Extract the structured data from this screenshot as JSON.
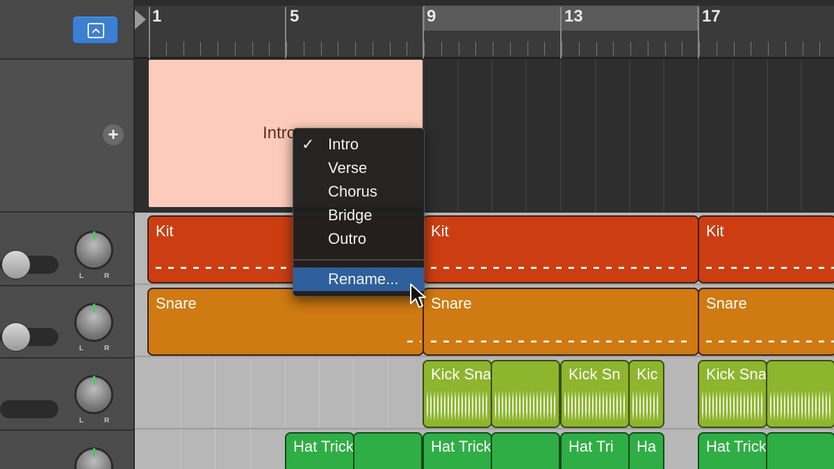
{
  "header": {
    "view_button_icon": "arrangement-view-icon",
    "add_icon": "+"
  },
  "ruler": {
    "bars": [
      "1",
      "5",
      "9",
      "13",
      "17"
    ]
  },
  "arrangement": {
    "region_label": "Intro"
  },
  "context_menu": {
    "items": [
      {
        "label": "Intro",
        "checked": true
      },
      {
        "label": "Verse",
        "checked": false
      },
      {
        "label": "Chorus",
        "checked": false
      },
      {
        "label": "Bridge",
        "checked": false
      },
      {
        "label": "Outro",
        "checked": false
      }
    ],
    "rename_label": "Rename..."
  },
  "tracks": {
    "knob_left": "L",
    "knob_right": "R",
    "kit": [
      "Kit",
      "Kit",
      "Kit"
    ],
    "snare": [
      "Snare",
      "Snare",
      "Snare"
    ],
    "loop": [
      "Kick Snare Loop",
      "Kick Sn",
      "Kic",
      "Kick Snare Loop"
    ],
    "hat": [
      "Hat Trick House",
      "Hat Trick House",
      "Hat Tri",
      "Ha",
      "Hat Trick House"
    ]
  },
  "colors": {
    "kit": "#cc3e12",
    "snare": "#cf7a12",
    "loop": "#8db52e",
    "hat": "#2fae45",
    "arrangement_region": "#fccbbb",
    "accent": "#3d7fd0"
  }
}
